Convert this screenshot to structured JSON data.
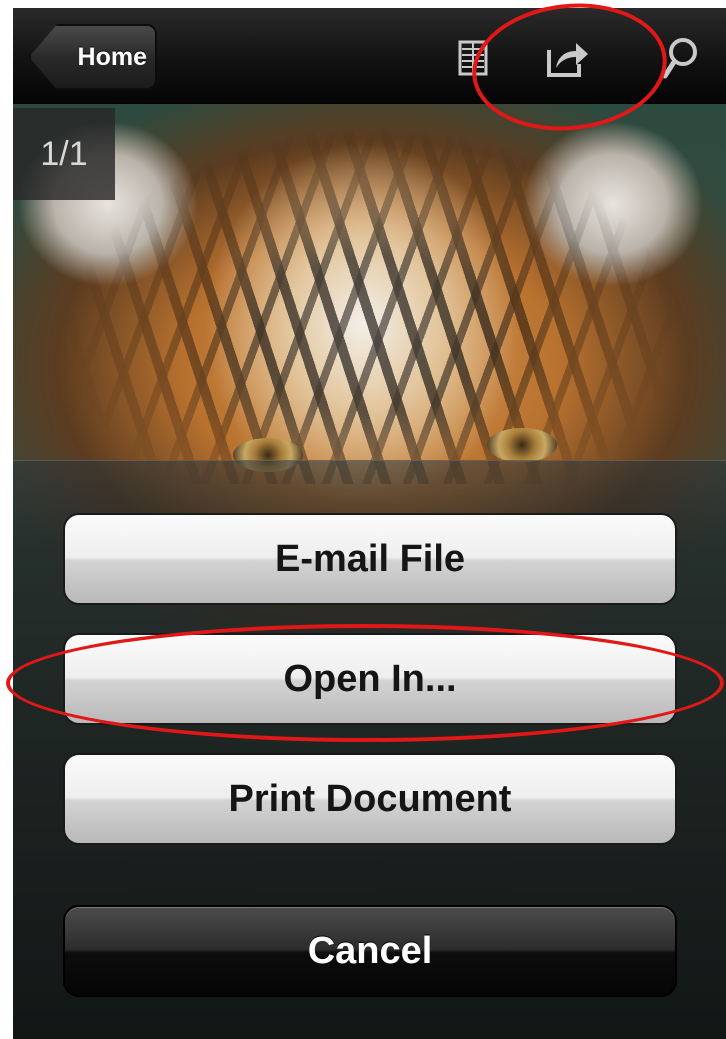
{
  "navbar": {
    "home_label": "Home",
    "icons": [
      "list-view-icon",
      "share-icon",
      "search-icon"
    ]
  },
  "viewer": {
    "page_indicator": "1/1"
  },
  "action_sheet": {
    "email_label": "E-mail File",
    "open_in_label": "Open In...",
    "print_label": "Print Document",
    "cancel_label": "Cancel"
  },
  "annotations": {
    "color": "#e21818",
    "highlighted": [
      "share-icon",
      "open-in-button"
    ]
  }
}
